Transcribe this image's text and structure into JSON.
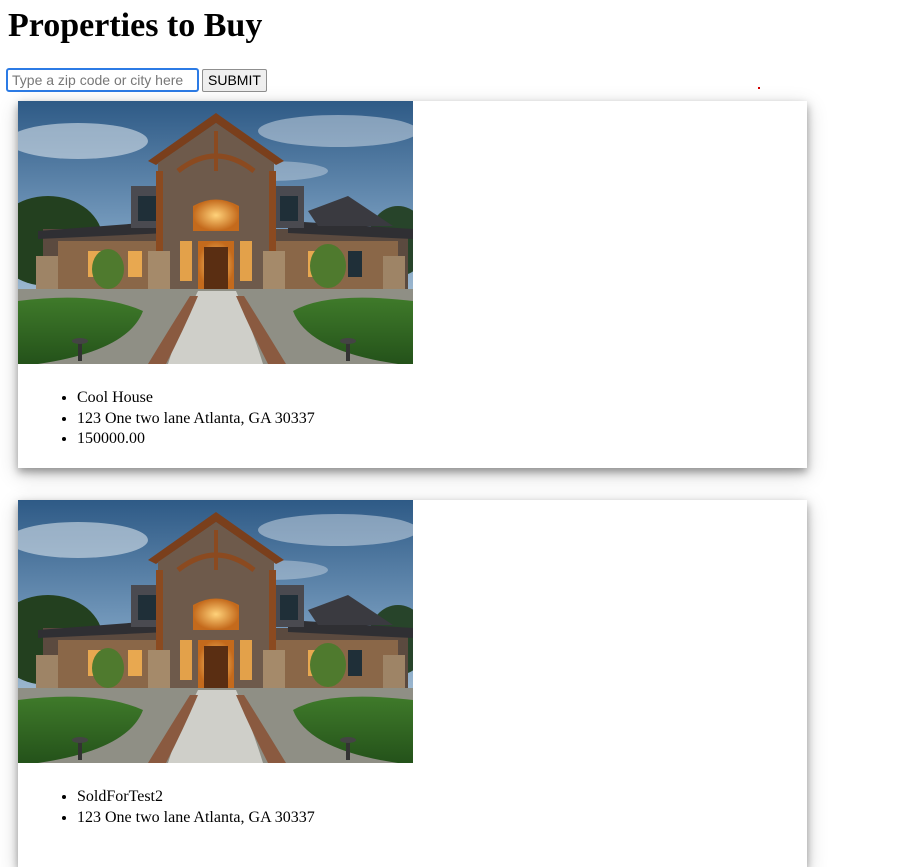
{
  "page": {
    "title": "Properties to Buy"
  },
  "search": {
    "placeholder": "Type a zip code or city here",
    "submit_label": "SUBMIT"
  },
  "listings": [
    {
      "name": "Cool House",
      "address": "123 One two lane Atlanta, GA 30337",
      "price": "150000.00"
    },
    {
      "name": "SoldForTest2",
      "address": "123 One two lane Atlanta, GA 30337"
    }
  ],
  "colors": {
    "input_focus_border": "#2c7be5",
    "marker_dot": "#d40000"
  }
}
